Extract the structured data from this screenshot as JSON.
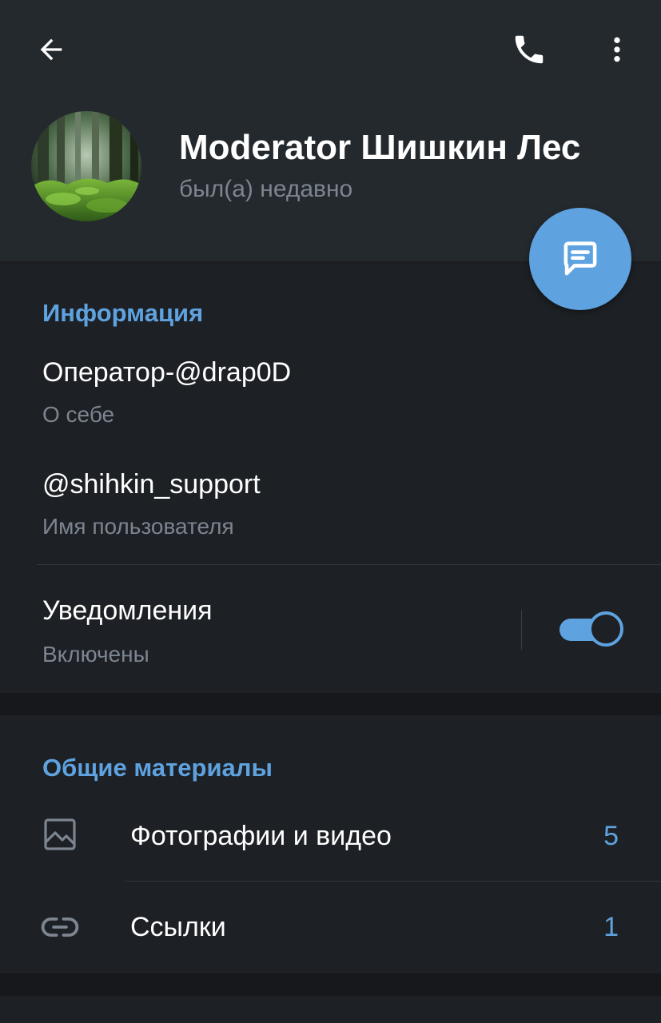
{
  "header": {
    "name": "Moderator Шишкин Лес",
    "status": "был(а) недавно"
  },
  "info": {
    "title": "Информация",
    "bio_value": "Оператор-@drap0D",
    "bio_label": "О себе",
    "username_value": "@shihkin_support",
    "username_label": "Имя пользователя",
    "notifications_label": "Уведомления",
    "notifications_state": "Включены",
    "notifications_enabled": true
  },
  "media": {
    "title": "Общие материалы",
    "items": [
      {
        "label": "Фотографии и видео",
        "count": "5",
        "icon": "image-icon"
      },
      {
        "label": "Ссылки",
        "count": "1",
        "icon": "link-icon"
      }
    ]
  },
  "colors": {
    "accent": "#5ea2df",
    "header_bg": "#24292e",
    "body_bg": "#1d2024",
    "secondary_text": "#7c8590"
  }
}
